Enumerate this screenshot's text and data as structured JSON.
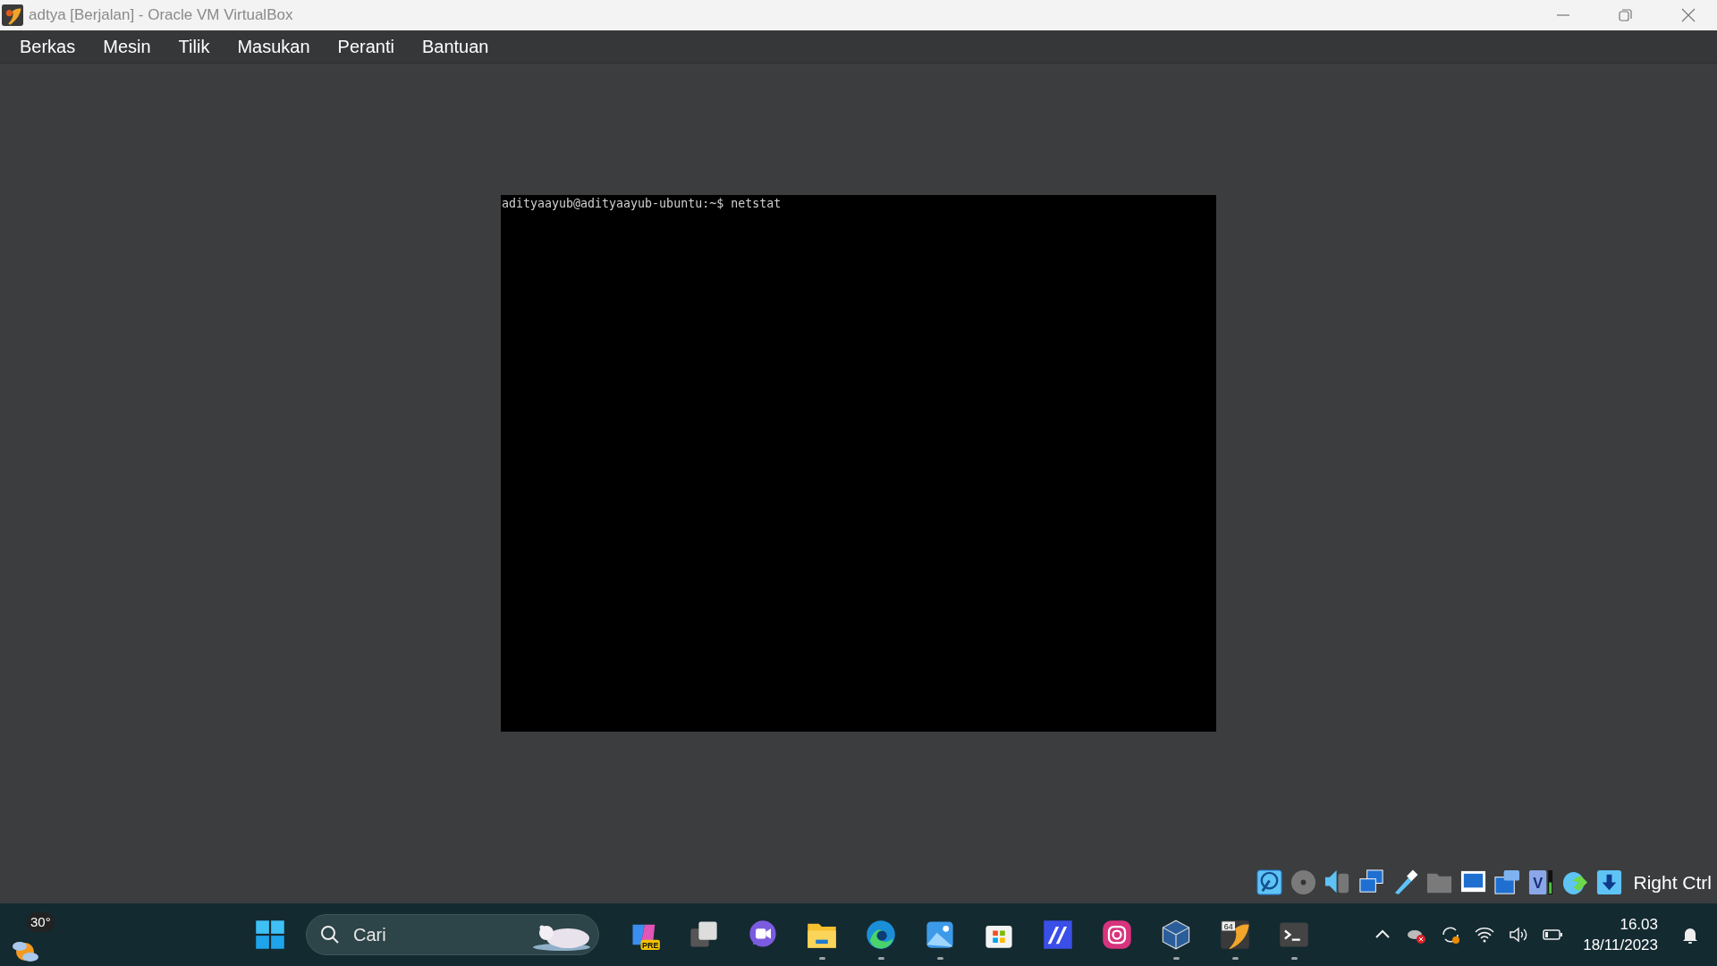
{
  "window": {
    "title": "adtya [Berjalan] - Oracle VM VirtualBox"
  },
  "menu": [
    "Berkas",
    "Mesin",
    "Tilik",
    "Masukan",
    "Peranti",
    "Bantuan"
  ],
  "terminal": {
    "lines": [
      "adityaayub@adityaayub-ubuntu:~$ netstat"
    ]
  },
  "status_bar": {
    "icons": [
      {
        "kind": "disk"
      },
      {
        "kind": "optical"
      },
      {
        "kind": "audio"
      },
      {
        "kind": "network"
      },
      {
        "kind": "usb"
      },
      {
        "kind": "folder"
      },
      {
        "kind": "display"
      },
      {
        "kind": "capture"
      },
      {
        "kind": "cpu",
        "letter": "V"
      },
      {
        "kind": "mouse"
      },
      {
        "kind": "download"
      }
    ],
    "host_key": "Right Ctrl"
  },
  "taskbar": {
    "weather": "30°",
    "search": {
      "placeholder": "Cari"
    },
    "apps": [
      {
        "kind": "copilot",
        "badge": "PRE",
        "running": false
      },
      {
        "kind": "taskview",
        "running": false
      },
      {
        "kind": "chat",
        "running": false
      },
      {
        "kind": "explorer",
        "running": true
      },
      {
        "kind": "edge",
        "running": true
      },
      {
        "kind": "photos",
        "running": true
      },
      {
        "kind": "store",
        "running": false
      },
      {
        "kind": "ai",
        "running": false
      },
      {
        "kind": "camera",
        "running": false
      },
      {
        "kind": "cube",
        "running": true
      },
      {
        "kind": "vbox",
        "badge": "64",
        "running": true
      },
      {
        "kind": "terminal",
        "running": true
      }
    ],
    "clock": {
      "time": "16.03",
      "date": "18/11/2023"
    }
  }
}
